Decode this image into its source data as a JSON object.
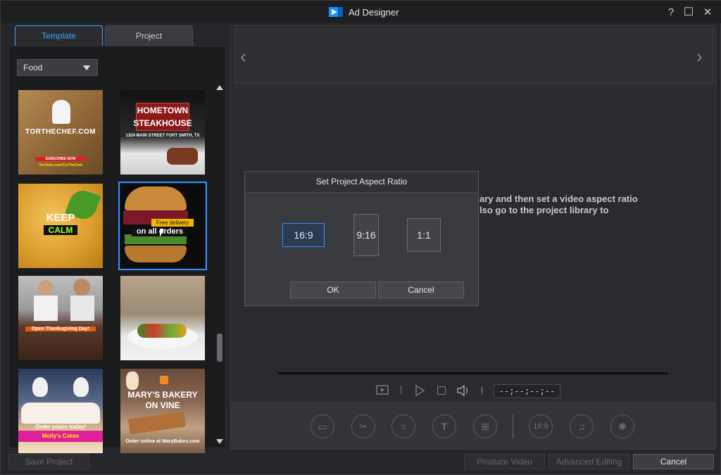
{
  "window": {
    "title": "Ad Designer",
    "help": "?",
    "maximize": "☐",
    "close": "✕"
  },
  "tabs": [
    "Template",
    "Project"
  ],
  "category": {
    "selected": "Food"
  },
  "templates": [
    {
      "line1": "TORTHECHEF.COM",
      "line2": "SUBSCRIBE NOW",
      "line3": "YouTube.com/TorTheChef"
    },
    {
      "line1": "HOMETOWN",
      "line2": "STEAKHOUSE",
      "line3": "1324 MAIN STREET FORT SMITH, TX"
    },
    {
      "line1": "KEEP",
      "line2": "CALM"
    },
    {
      "line1": "Free delivery",
      "line2": "on all orders"
    },
    {
      "line1": "Open Thanksgiving Day!"
    },
    {
      "line1": ""
    },
    {
      "line1": "Order yours today!",
      "line2": "Molly's Cakes"
    },
    {
      "line1": "MARY'S BAKERY",
      "line2": "ON VINE",
      "line3": "Order online at MaryBakes.com"
    }
  ],
  "background_text": "ary and then set a video aspect ratio\nlso go to the project library to",
  "player": {
    "timecode": "--;--;--;--"
  },
  "tools": {
    "aspect_label": "16:9"
  },
  "dialog": {
    "title": "Set Project Aspect Ratio",
    "ratios": [
      "16:9",
      "9:16",
      "1:1"
    ],
    "ok": "OK",
    "cancel": "Cancel"
  },
  "bottom": {
    "save_project": "Save Project",
    "produce_video": "Produce Video",
    "advanced_editing": "Advanced Editing",
    "cancel": "Cancel"
  },
  "colors": {
    "accent": "#2f8fff",
    "background": "#26272a"
  }
}
